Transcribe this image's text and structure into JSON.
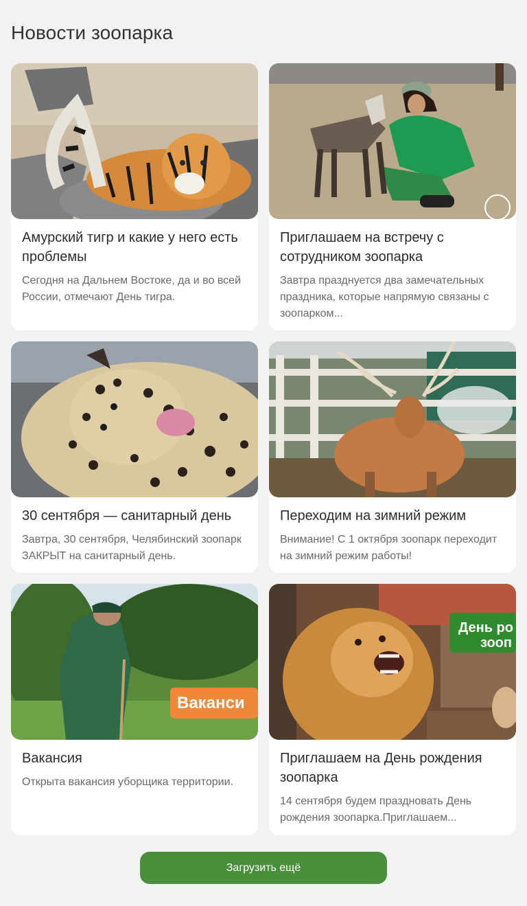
{
  "page": {
    "title": "Новости зоопарка"
  },
  "news": [
    {
      "title": "Амурский тигр и какие у него есть проблемы",
      "description": "Сегодня на Дальнем Востоке, да и во всей России, отмечают День тигра.",
      "image": "tiger-photo"
    },
    {
      "title": "Приглашаем на встречу с сотрудником зоопарка",
      "description": "Завтра празднуется два замечательных праздника, которые напрямую связаны с зоопарком...",
      "image": "zookeeper-with-goat-photo"
    },
    {
      "title": "30 сентября — санитарный день",
      "description": "Завтра, 30 сентября, Челябинский зоопарк ЗАКРЫТ на санитарный день.",
      "image": "leopard-photo"
    },
    {
      "title": "Переходим на зимний режим",
      "description": "Внимание! С 1 октября зоопарк переходит на зимний режим работы!",
      "image": "deer-photo"
    },
    {
      "title": "Вакансия",
      "description": "Открыта вакансия уборщика территории.",
      "image": "worker-photo",
      "image_banner": "Ваканси"
    },
    {
      "title": "Приглашаем на День рождения зоопарка",
      "description": "14 сентября будем праздновать День рождения зоопарка.Приглашаем...",
      "image": "lion-photo",
      "image_banner": "День ро зооп"
    }
  ],
  "actions": {
    "load_more_label": "Загрузить ещё"
  },
  "colors": {
    "background": "#f2f2f3",
    "card": "#ffffff",
    "accent_green": "#4a8f3c",
    "banner_orange": "#f0883a",
    "banner_green": "#2e8b2e"
  }
}
